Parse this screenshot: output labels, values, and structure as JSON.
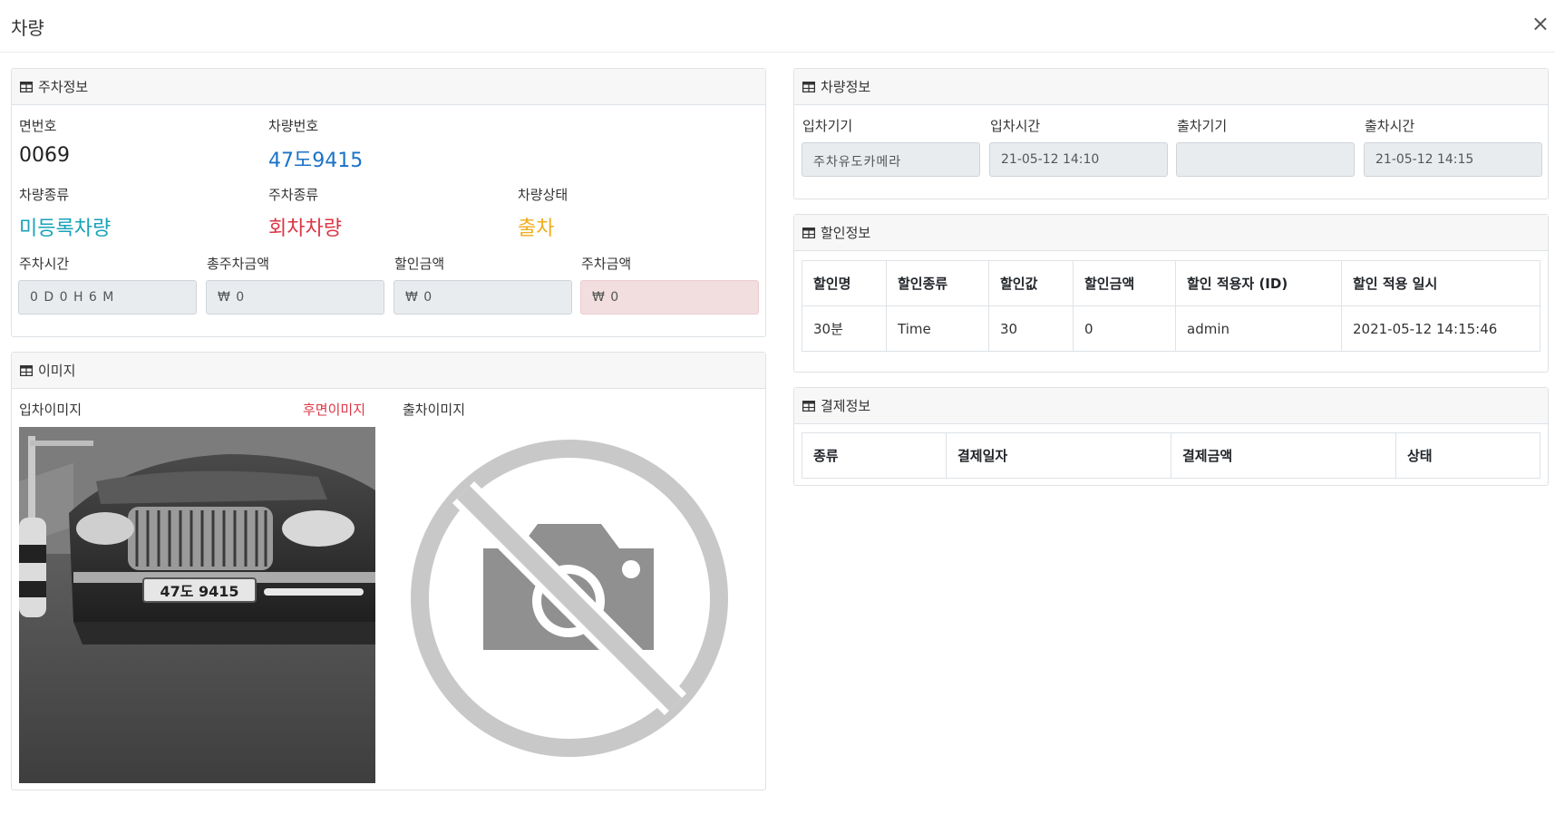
{
  "modal": {
    "title": "차량",
    "close": "×"
  },
  "parking": {
    "header": "주차정보",
    "space_no_label": "면번호",
    "space_no": "0069",
    "plate_label": "차량번호",
    "plate": "47도9415",
    "vehicle_type_label": "차량종류",
    "vehicle_type": "미등록차량",
    "parking_type_label": "주차종류",
    "parking_type": "회차차량",
    "status_label": "차량상태",
    "status": "출차",
    "duration_label": "주차시간",
    "duration": "0 D 0 H 6 M",
    "total_fee_label": "총주차금액",
    "total_fee": "₩ 0",
    "discount_amount_label": "할인금액",
    "discount_amount": "₩ 0",
    "fee_label": "주차금액",
    "fee": "₩ 0"
  },
  "images": {
    "header": "이미지",
    "entry_label": "입차이미지",
    "rear_link": "후면이미지",
    "exit_label": "출차이미지",
    "entry_plate_text": "47도 9415"
  },
  "vehicle": {
    "header": "차량정보",
    "entry_device_label": "입차기기",
    "entry_device": "주차유도카메라",
    "entry_time_label": "입차시간",
    "entry_time": "21-05-12 14:10",
    "exit_device_label": "출차기기",
    "exit_device": "",
    "exit_time_label": "출차시간",
    "exit_time": "21-05-12 14:15"
  },
  "discount": {
    "header": "할인정보",
    "columns": [
      "할인명",
      "할인종류",
      "할인값",
      "할인금액",
      "할인 적용자 (ID)",
      "할인 적용 일시"
    ],
    "rows": [
      [
        "30분",
        "Time",
        "30",
        "0",
        "admin",
        "2021-05-12 14:15:46"
      ]
    ]
  },
  "payment": {
    "header": "결제정보",
    "columns": [
      "종류",
      "결제일자",
      "결제금액",
      "상태"
    ]
  },
  "colors": {
    "blue": "#1a73c8",
    "teal": "#17a2b8",
    "red": "#dc3545",
    "yellow": "#f0ad1a"
  }
}
